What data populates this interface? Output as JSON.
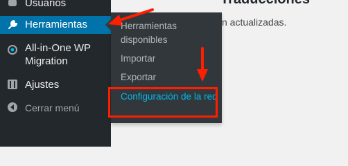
{
  "sidebar": {
    "items": [
      {
        "label": "Usuarios",
        "icon": "users-icon"
      },
      {
        "label": "Herramientas",
        "icon": "wrench-icon"
      },
      {
        "label": "All-in-One WP Migration",
        "icon": "migration-icon"
      },
      {
        "label": "Ajustes",
        "icon": "sliders-icon"
      },
      {
        "label": "Cerrar menú",
        "icon": "collapse-icon"
      }
    ],
    "active_color": "#0073aa"
  },
  "submenu": {
    "items": [
      {
        "label": "Herramientas disponibles"
      },
      {
        "label": "Importar"
      },
      {
        "label": "Exportar"
      },
      {
        "label": "Configuración de la red"
      }
    ]
  },
  "content": {
    "title": "Traducciones",
    "text": "n actualizadas."
  },
  "annotations": {
    "arrow_color": "#ff1f00"
  }
}
